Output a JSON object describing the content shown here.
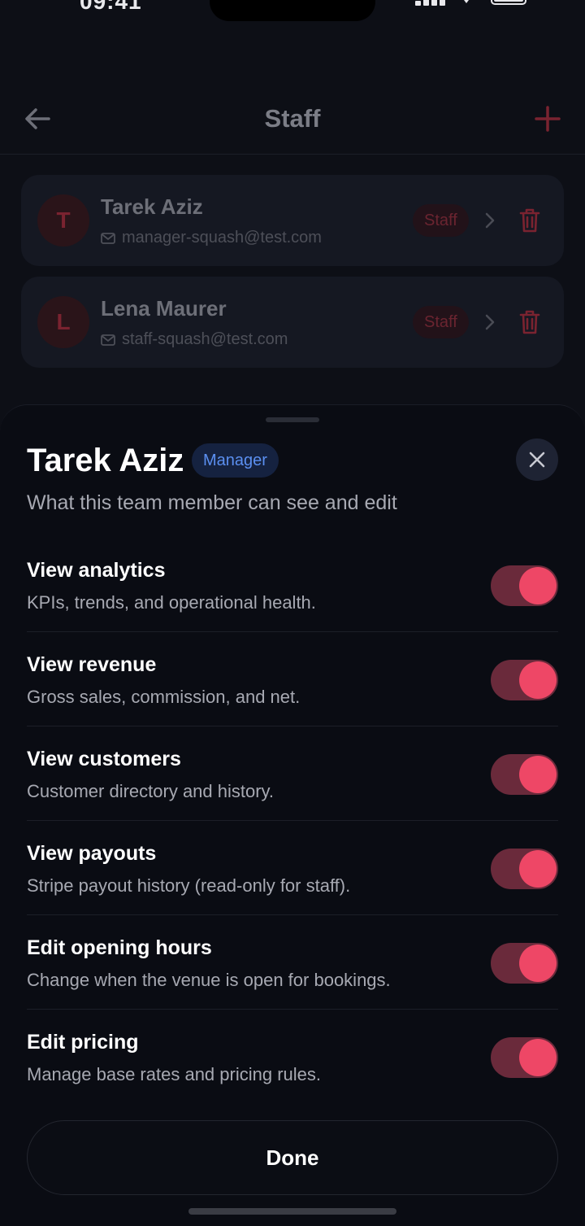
{
  "status_bar": {
    "time": "09:41"
  },
  "header": {
    "title": "Staff"
  },
  "staff": [
    {
      "initial": "T",
      "name": "Tarek Aziz",
      "email": "manager-squash@test.com",
      "role": "Staff"
    },
    {
      "initial": "L",
      "name": "Lena Maurer",
      "email": "staff-squash@test.com",
      "role": "Staff"
    }
  ],
  "sheet": {
    "title": "Tarek Aziz",
    "badge": "Manager",
    "subtitle": "What this team member can see and edit",
    "permissions": [
      {
        "title": "View analytics",
        "desc": "KPIs, trends, and operational health.",
        "enabled": true
      },
      {
        "title": "View revenue",
        "desc": "Gross sales, commission, and net.",
        "enabled": true
      },
      {
        "title": "View customers",
        "desc": "Customer directory and history.",
        "enabled": true
      },
      {
        "title": "View payouts",
        "desc": "Stripe payout history (read-only for staff).",
        "enabled": true
      },
      {
        "title": "Edit opening hours",
        "desc": "Change when the venue is open for bookings.",
        "enabled": true
      },
      {
        "title": "Edit pricing",
        "desc": "Manage base rates and pricing rules.",
        "enabled": true
      }
    ],
    "done_label": "Done"
  },
  "colors": {
    "accent": "#ee4766",
    "background": "#0d0f16",
    "manager_badge": "#5b8ff0"
  },
  "icons": [
    "back-arrow-icon",
    "plus-icon",
    "mail-icon",
    "chevron-right-icon",
    "trash-icon",
    "close-icon"
  ]
}
